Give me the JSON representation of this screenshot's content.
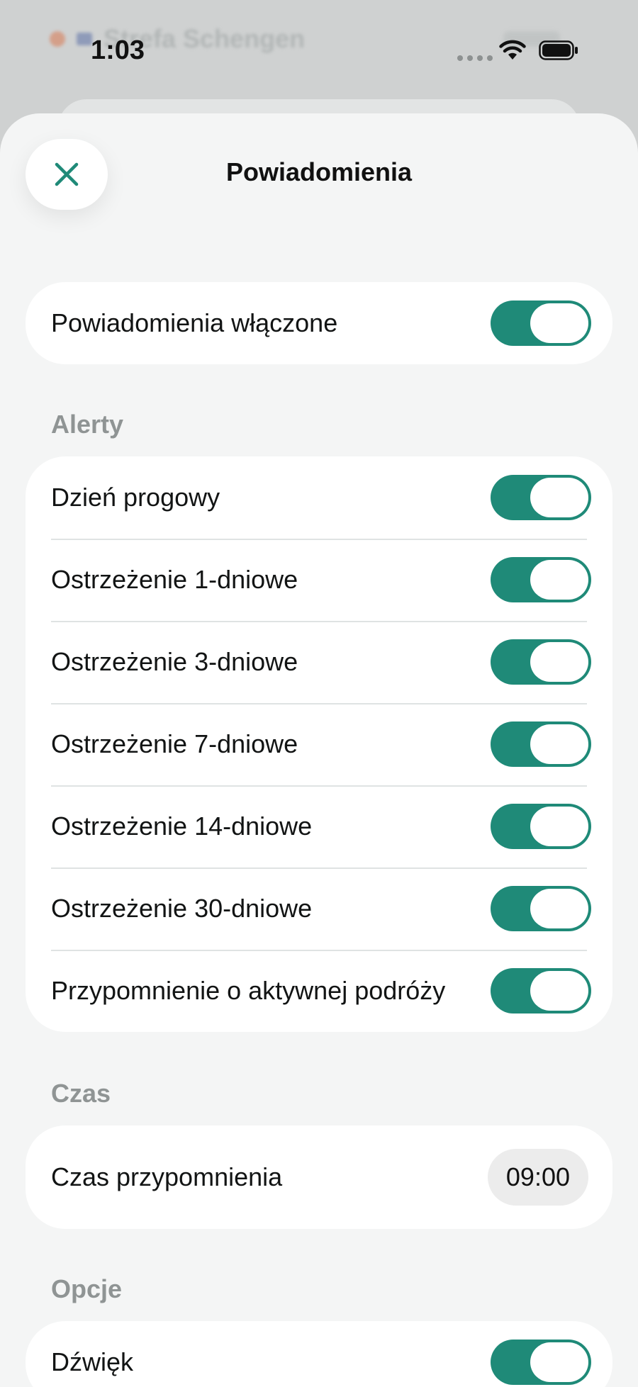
{
  "status_bar": {
    "time": "1:03"
  },
  "background_app": {
    "row_text": "Strefa Schengen"
  },
  "sheet": {
    "title": "Powiadomienia"
  },
  "master": {
    "label": "Powiadomienia włączone",
    "on": true
  },
  "alerts": {
    "header": "Alerty",
    "items": [
      {
        "label": "Dzień progowy",
        "on": true
      },
      {
        "label": "Ostrzeżenie 1-dniowe",
        "on": true
      },
      {
        "label": "Ostrzeżenie 3-dniowe",
        "on": true
      },
      {
        "label": "Ostrzeżenie 7-dniowe",
        "on": true
      },
      {
        "label": "Ostrzeżenie 14-dniowe",
        "on": true
      },
      {
        "label": "Ostrzeżenie 30-dniowe",
        "on": true
      },
      {
        "label": "Przypomnienie o aktywnej podróży",
        "on": true
      }
    ]
  },
  "time_section": {
    "header": "Czas",
    "label": "Czas przypomnienia",
    "value": "09:00"
  },
  "options": {
    "header": "Opcje",
    "items": [
      {
        "label": "Dźwięk",
        "on": true
      }
    ]
  },
  "colors": {
    "accent": "#1f8a78",
    "sheet_bg": "#f4f5f5",
    "card_bg": "#ffffff",
    "section_header": "#8f9494"
  },
  "icons": {
    "close": "close-icon",
    "wifi": "wifi-icon",
    "battery": "battery-icon"
  }
}
